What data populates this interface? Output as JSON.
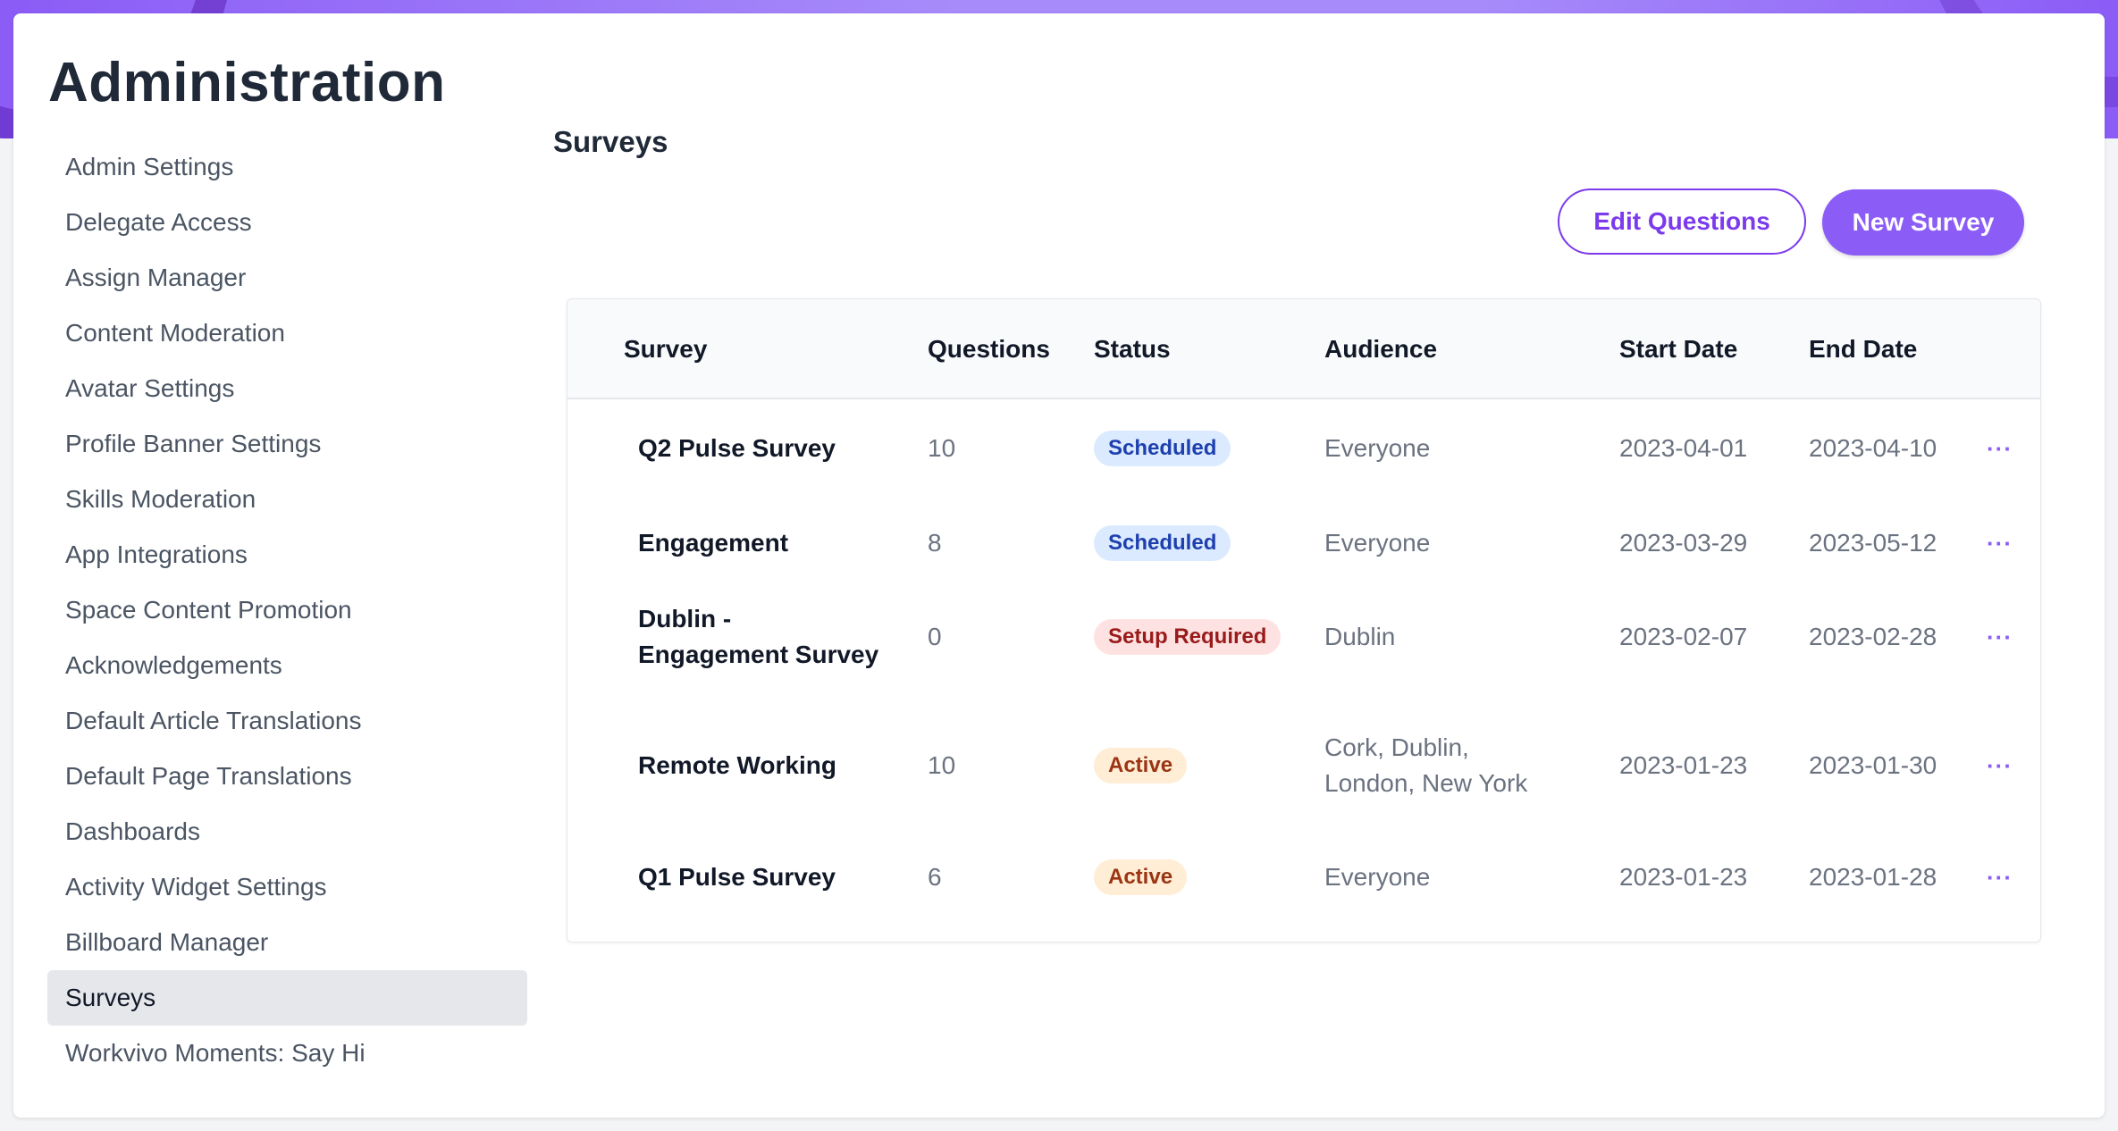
{
  "app": {
    "title": "Administration"
  },
  "sidebar": {
    "items": [
      {
        "label": "Admin Settings"
      },
      {
        "label": "Delegate Access"
      },
      {
        "label": "Assign Manager"
      },
      {
        "label": "Content Moderation"
      },
      {
        "label": "Avatar Settings"
      },
      {
        "label": "Profile Banner Settings"
      },
      {
        "label": "Skills Moderation"
      },
      {
        "label": "App Integrations"
      },
      {
        "label": "Space Content Promotion"
      },
      {
        "label": "Acknowledgements"
      },
      {
        "label": "Default Article Translations"
      },
      {
        "label": "Default Page Translations"
      },
      {
        "label": "Dashboards"
      },
      {
        "label": "Activity Widget Settings"
      },
      {
        "label": "Billboard Manager"
      },
      {
        "label": "Surveys",
        "active": true
      },
      {
        "label": "Workvivo Moments: Say Hi"
      }
    ]
  },
  "main": {
    "section_title": "Surveys",
    "edit_questions_label": "Edit Questions",
    "new_survey_label": "New Survey",
    "table": {
      "columns": [
        "Survey",
        "Questions",
        "Status",
        "Audience",
        "Start Date",
        "End Date"
      ],
      "rows": [
        {
          "survey": "Q2 Pulse Survey",
          "survey_line2": "",
          "questions": "10",
          "status": "Scheduled",
          "status_kind": "scheduled",
          "audience": "Everyone",
          "audience_line2": "",
          "start": "2023-04-01",
          "end": "2023-04-10"
        },
        {
          "survey": "Engagement",
          "survey_line2": "",
          "questions": "8",
          "status": "Scheduled",
          "status_kind": "scheduled",
          "audience": "Everyone",
          "audience_line2": "",
          "start": "2023-03-29",
          "end": "2023-05-12"
        },
        {
          "survey": "Dublin -",
          "survey_line2": "Engagement Survey",
          "questions": "0",
          "status": "Setup Required",
          "status_kind": "setup",
          "audience": "Dublin",
          "audience_line2": "",
          "start": "2023-02-07",
          "end": "2023-02-28"
        },
        {
          "survey": "Remote Working",
          "survey_line2": "",
          "questions": "10",
          "status": "Active",
          "status_kind": "active",
          "audience": "Cork, Dublin,",
          "audience_line2": "London, New York",
          "start": "2023-01-23",
          "end": "2023-01-30"
        },
        {
          "survey": "Q1 Pulse Survey",
          "survey_line2": "",
          "questions": "6",
          "status": "Active",
          "status_kind": "active",
          "audience": "Everyone",
          "audience_line2": "",
          "start": "2023-01-23",
          "end": "2023-01-28"
        }
      ],
      "row_menu_glyph": "···"
    }
  },
  "colors": {
    "accent": "#8b5cf6",
    "accent_dark": "#7c3aed",
    "header_band": "#a78bfa"
  },
  "icons": {
    "row_menu": "more-horizontal-icon"
  }
}
